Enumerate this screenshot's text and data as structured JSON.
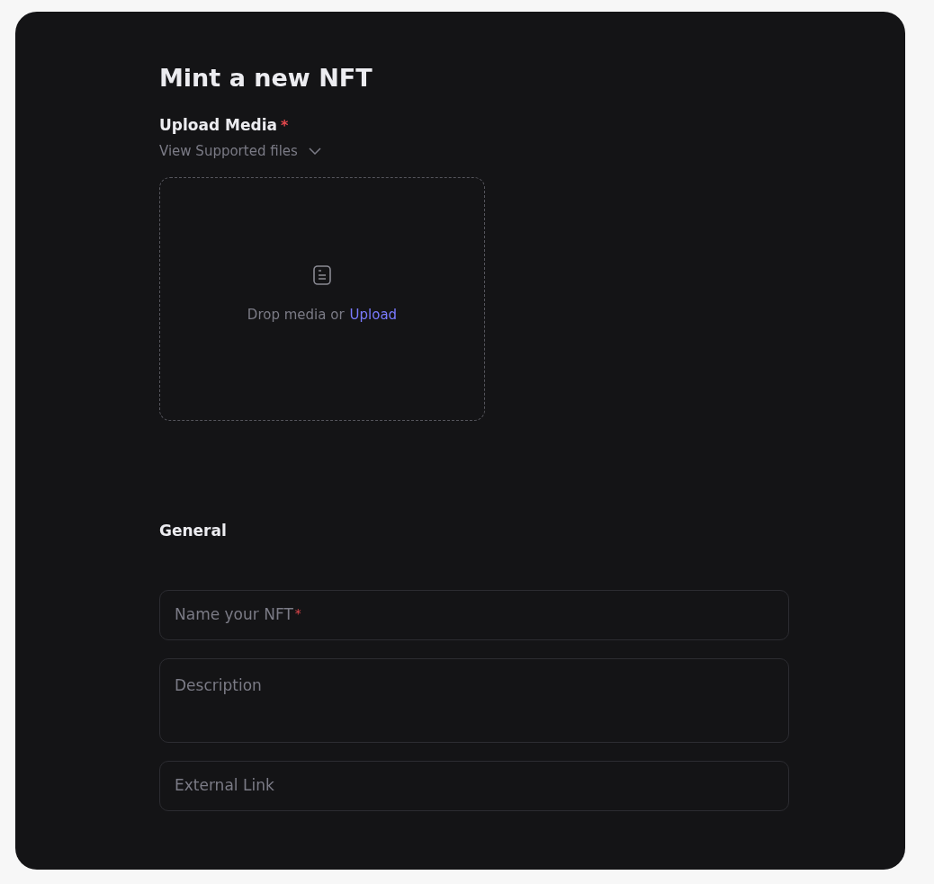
{
  "title": "Mint a new NFT",
  "upload": {
    "label": "Upload Media",
    "required_mark": "*",
    "supported_toggle": "View Supported files",
    "expanded": false,
    "drop_text": "Drop media or",
    "upload_link": "Upload"
  },
  "section": "General",
  "fields": [
    {
      "kind": "input",
      "placeholder": "Name your NFT",
      "required_mark": "*"
    },
    {
      "kind": "textarea",
      "placeholder": "Description"
    },
    {
      "kind": "input",
      "placeholder": "External Link"
    }
  ]
}
